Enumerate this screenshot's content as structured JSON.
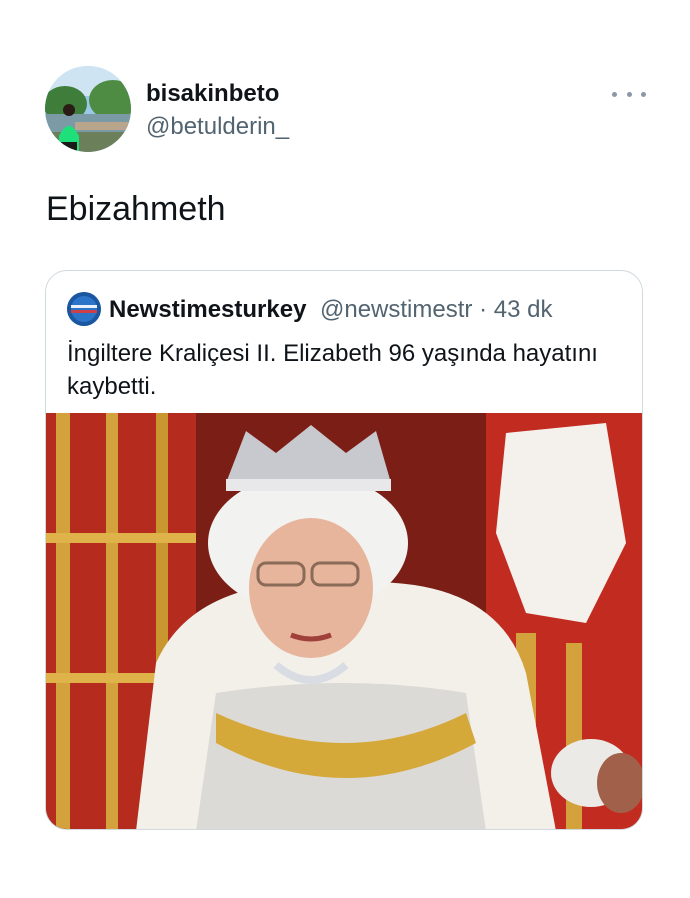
{
  "user": {
    "display_name": "bisakinbeto",
    "handle": "@betulderin_"
  },
  "tweet": {
    "text": "Ebizahmeth"
  },
  "quoted_tweet": {
    "display_name": "Newstimesturkey",
    "handle": "@newstimestr",
    "separator": "·",
    "time": "43 dk",
    "text": "İngiltere Kraliçesi II. Elizabeth 96 yaşında hayatını kaybetti.",
    "avatar_text": "NEWS TIMES TURKEY"
  },
  "icons": {
    "more": "more-options-icon"
  },
  "colors": {
    "text_primary": "#0f1419",
    "text_secondary": "#536471",
    "border": "#cfd9de",
    "background": "#ffffff"
  }
}
